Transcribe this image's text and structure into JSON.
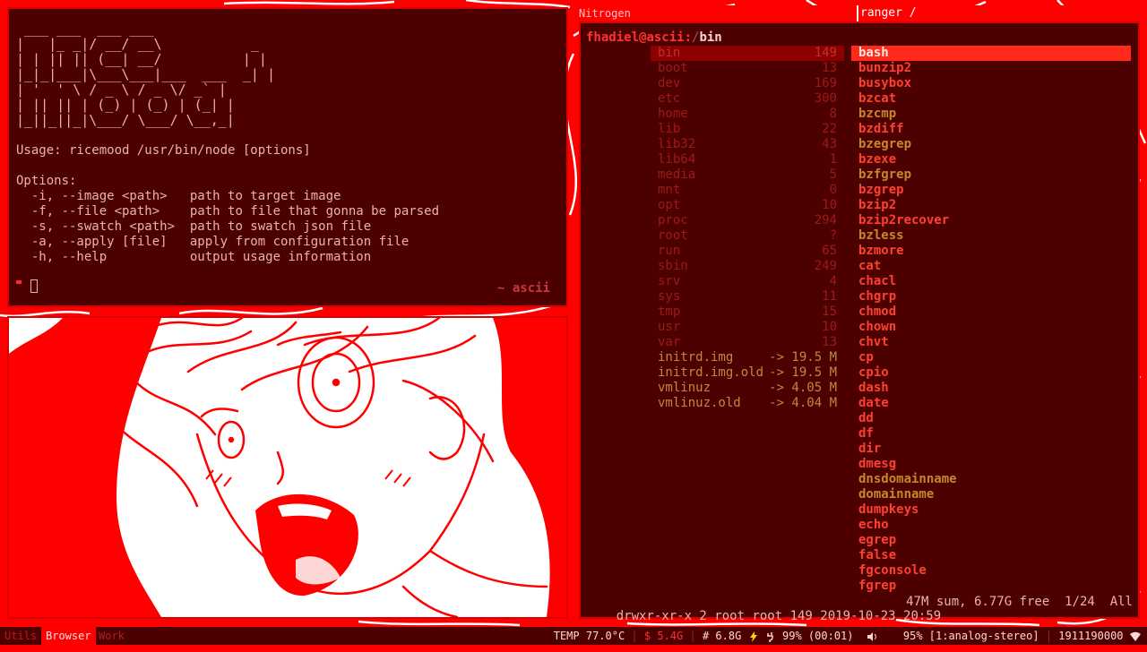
{
  "window_titles": {
    "left": "Nitrogen",
    "right": "ranger /"
  },
  "terminal": {
    "ascii_logo": " ___ ___  ___ ___\n|   |_ _|/ __/ __\\           _\n| | || || (__| __/          | |\n|_|_|___|\\___\\___|___  ___  _| |\n| '  ' \\ / _ \\ / _ \\/ _` |\n| || || | (_) | (_) | (_| |\n|_||_||_|\\___/ \\___/ \\__,_|",
    "usage": "Usage: ricemood /usr/bin/node [options]",
    "options_header": "Options:",
    "options": [
      {
        "flag": "  -i, --image <path>   ",
        "desc": "path to target image"
      },
      {
        "flag": "  -f, --file <path>    ",
        "desc": "path to file that gonna be parsed"
      },
      {
        "flag": "  -s, --swatch <path>  ",
        "desc": "path to swatch json file"
      },
      {
        "flag": "  -a, --apply [file]   ",
        "desc": "apply from configuration file"
      },
      {
        "flag": "  -h, --help           ",
        "desc": "output usage information"
      }
    ],
    "prompt_host": "~ ascii"
  },
  "ranger": {
    "path_user": "fhadiel@ascii:",
    "path_sep": "/",
    "path_current": "bin",
    "dirs": [
      {
        "name": "bin",
        "size": "149",
        "selected": true
      },
      {
        "name": "boot",
        "size": "13"
      },
      {
        "name": "dev",
        "size": "169"
      },
      {
        "name": "etc",
        "size": "300"
      },
      {
        "name": "home",
        "size": "8"
      },
      {
        "name": "lib",
        "size": "22"
      },
      {
        "name": "lib32",
        "size": "43"
      },
      {
        "name": "lib64",
        "size": "1"
      },
      {
        "name": "media",
        "size": "5"
      },
      {
        "name": "mnt",
        "size": "0"
      },
      {
        "name": "opt",
        "size": "10"
      },
      {
        "name": "proc",
        "size": "294"
      },
      {
        "name": "root",
        "size": "?"
      },
      {
        "name": "run",
        "size": "65"
      },
      {
        "name": "sbin",
        "size": "249"
      },
      {
        "name": "srv",
        "size": "4"
      },
      {
        "name": "sys",
        "size": "11"
      },
      {
        "name": "tmp",
        "size": "15"
      },
      {
        "name": "usr",
        "size": "10"
      },
      {
        "name": "var",
        "size": "13"
      },
      {
        "name": "initrd.img",
        "size": "-> 19.5 M",
        "link": true
      },
      {
        "name": "initrd.img.old",
        "size": "-> 19.5 M",
        "link": true
      },
      {
        "name": "vmlinuz",
        "size": "-> 4.05 M",
        "link": true
      },
      {
        "name": "vmlinuz.old",
        "size": "-> 4.04 M",
        "link": true
      }
    ],
    "files": [
      {
        "name": "bash",
        "selected": true
      },
      {
        "name": "bunzip2"
      },
      {
        "name": "busybox"
      },
      {
        "name": "bzcat"
      },
      {
        "name": "bzcmp",
        "link": true
      },
      {
        "name": "bzdiff"
      },
      {
        "name": "bzegrep",
        "link": true
      },
      {
        "name": "bzexe"
      },
      {
        "name": "bzfgrep",
        "link": true
      },
      {
        "name": "bzgrep"
      },
      {
        "name": "bzip2"
      },
      {
        "name": "bzip2recover"
      },
      {
        "name": "bzless",
        "link": true
      },
      {
        "name": "bzmore"
      },
      {
        "name": "cat"
      },
      {
        "name": "chacl"
      },
      {
        "name": "chgrp"
      },
      {
        "name": "chmod"
      },
      {
        "name": "chown"
      },
      {
        "name": "chvt"
      },
      {
        "name": "cp"
      },
      {
        "name": "cpio"
      },
      {
        "name": "dash"
      },
      {
        "name": "date"
      },
      {
        "name": "dd"
      },
      {
        "name": "df"
      },
      {
        "name": "dir"
      },
      {
        "name": "dmesg"
      },
      {
        "name": "dnsdomainname",
        "link": true
      },
      {
        "name": "domainname",
        "link": true
      },
      {
        "name": "dumpkeys"
      },
      {
        "name": "echo"
      },
      {
        "name": "egrep"
      },
      {
        "name": "false"
      },
      {
        "name": "fgconsole"
      },
      {
        "name": "fgrep"
      }
    ],
    "status_left": "drwxr-xr-x 2 root root 149 2019-10-23 20:59",
    "status_right": "47M sum, 6.77G free  1/24  All"
  },
  "bar": {
    "workspaces": [
      {
        "label": "Utils",
        "active": false
      },
      {
        "label": "Browser",
        "active": true
      },
      {
        "label": "Work",
        "active": false
      }
    ],
    "temp": "TEMP 77.0°C",
    "mem_label": "$",
    "mem_value": "5.4G",
    "disk_label": "#",
    "disk_value": "6.8G",
    "battery": "99% (00:01)",
    "volume": "95% [1:analog-stereo]",
    "clock": "1911190000"
  },
  "colors": {
    "accent": "#ff0000",
    "panel": "#4c0000",
    "text": "#e9b2b2",
    "highlight": "#ff2a1a"
  }
}
